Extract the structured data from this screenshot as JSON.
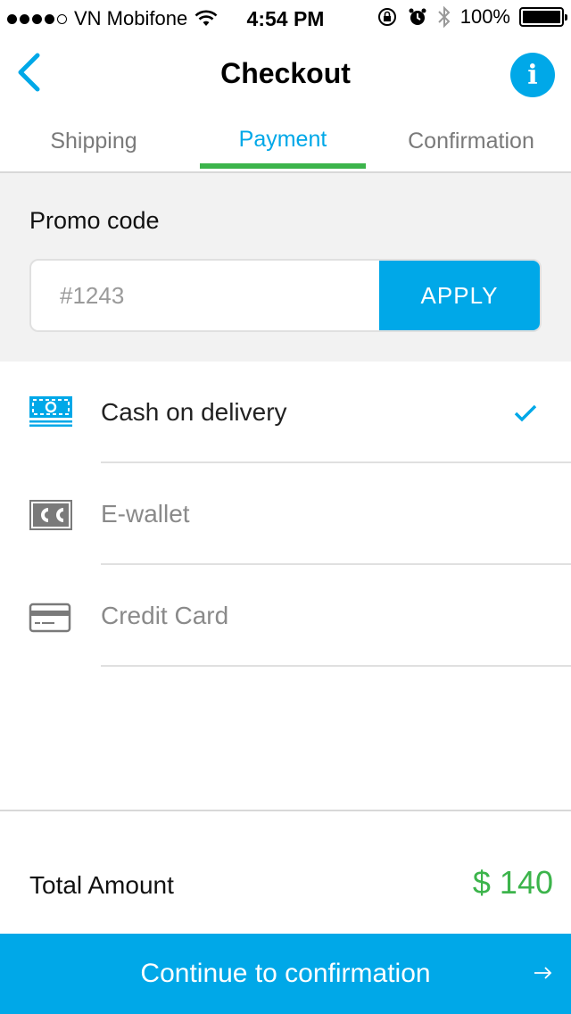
{
  "status_bar": {
    "carrier": "VN Mobifone",
    "time": "4:54 PM",
    "battery": "100%"
  },
  "nav": {
    "title": "Checkout",
    "info_symbol": "i"
  },
  "tabs": [
    {
      "label": "Shipping",
      "active": false
    },
    {
      "label": "Payment",
      "active": true
    },
    {
      "label": "Confirmation",
      "active": false
    }
  ],
  "promo": {
    "label": "Promo code",
    "placeholder": "#1243",
    "apply_label": "APPLY"
  },
  "payment_methods": [
    {
      "label": "Cash on delivery",
      "icon": "cash-icon",
      "selected": true
    },
    {
      "label": "E-wallet",
      "icon": "cc-icon",
      "selected": false
    },
    {
      "label": "Credit Card",
      "icon": "credit-card-icon",
      "selected": false
    }
  ],
  "total": {
    "label": "Total Amount",
    "value": "$ 140"
  },
  "continue_button": {
    "label": "Continue to confirmation"
  },
  "colors": {
    "accent": "#00a8e8",
    "green": "#3cb44b",
    "muted": "#8a8a8a"
  }
}
